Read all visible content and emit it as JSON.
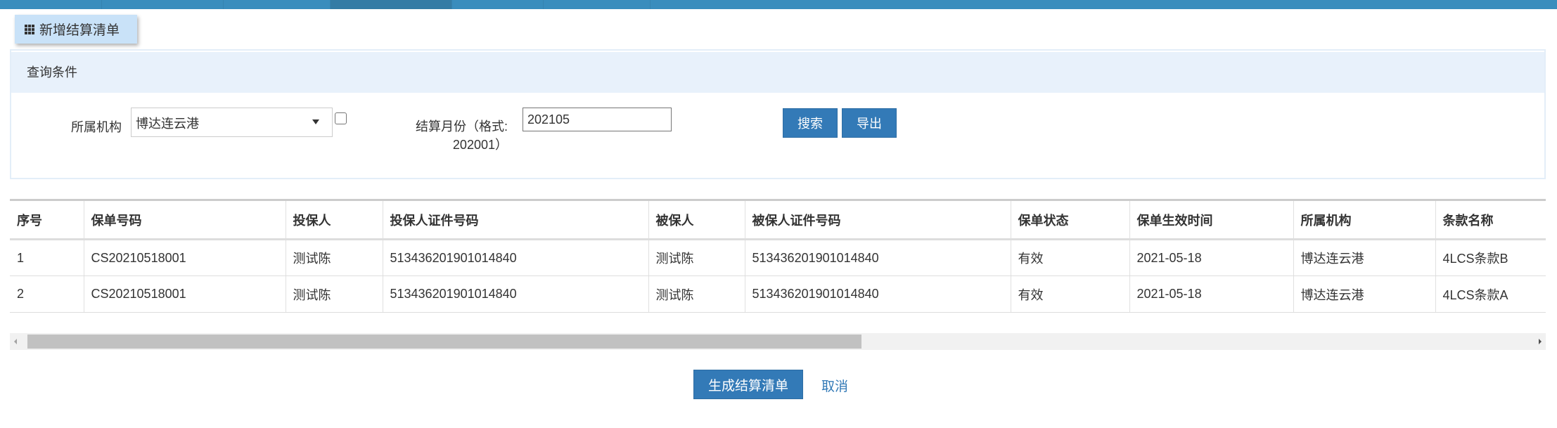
{
  "toolbar": {
    "new_button": "新增结算清单",
    "new_icon": "grid-icon"
  },
  "panel": {
    "title": "查询条件"
  },
  "filters": {
    "org_label": "所属机构",
    "org_value": "博达连云港",
    "month_label_line1": "结算月份（格式:",
    "month_label_line2": "202001）",
    "month_value": "202105",
    "search_button": "搜索",
    "export_button": "导出"
  },
  "table": {
    "headers": [
      "序号",
      "保单号码",
      "投保人",
      "投保人证件号码",
      "被保人",
      "被保人证件号码",
      "保单状态",
      "保单生效时间",
      "所属机构",
      "条款名称"
    ],
    "rows": [
      [
        "1",
        "CS20210518001",
        "测试陈",
        "513436201901014840",
        "测试陈",
        "513436201901014840",
        "有效",
        "2021-05-18",
        "博达连云港",
        "4LCS条款B"
      ],
      [
        "2",
        "CS20210518001",
        "测试陈",
        "513436201901014840",
        "测试陈",
        "513436201901014840",
        "有效",
        "2021-05-18",
        "博达连云港",
        "4LCS条款A"
      ]
    ]
  },
  "actions": {
    "generate_button": "生成结算清单",
    "cancel_link": "取消"
  },
  "colors": {
    "primary": "#337ab7",
    "topbar": "#3a8dbd",
    "panel_head": "#e8f1fb",
    "new_button_bg": "#c9e2f8"
  }
}
